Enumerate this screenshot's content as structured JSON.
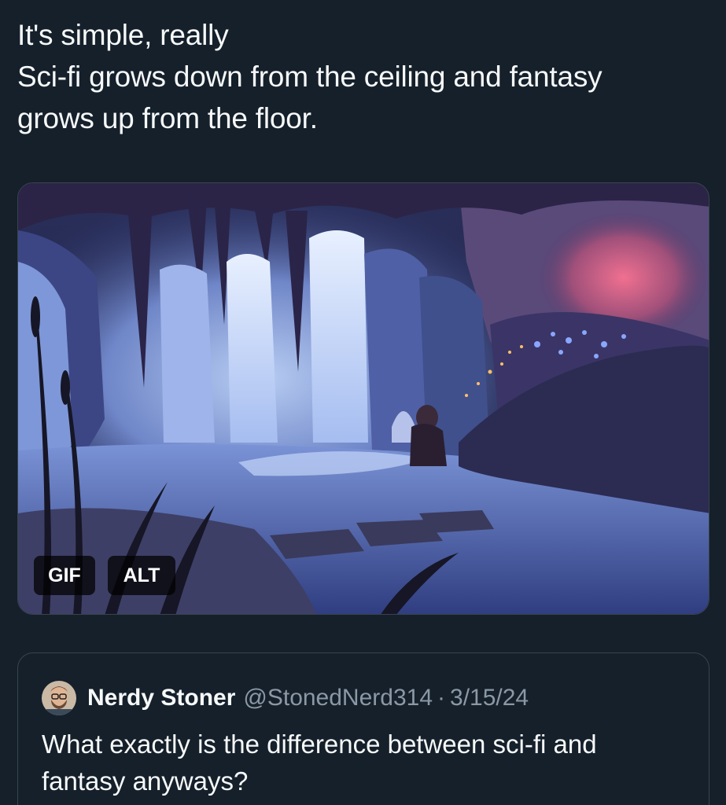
{
  "post": {
    "text_lines": [
      "It's simple, really",
      "Sci-fi grows down from the ceiling and fantasy",
      "grows up from the floor."
    ]
  },
  "media": {
    "gif_label": "GIF",
    "alt_label": "ALT",
    "type_icon": "cave-waterfall-gif"
  },
  "quoted_post": {
    "author_name": "Nerdy Stoner",
    "author_handle": "@StonedNerd314",
    "separator": "·",
    "date": "3/15/24",
    "text_lines": [
      "What exactly is the difference between sci-fi and",
      "fantasy anyways?"
    ]
  },
  "colors": {
    "background": "#15202b",
    "text_primary": "#f7f9f9",
    "text_secondary": "#8b98a5",
    "border": "#38444d"
  }
}
